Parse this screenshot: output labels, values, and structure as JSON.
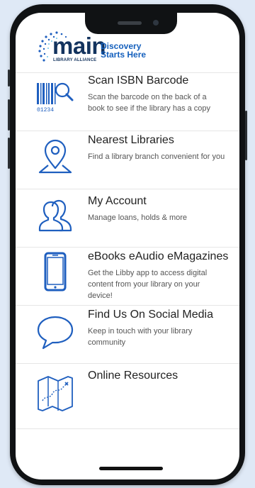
{
  "header": {
    "logo_main": "main",
    "logo_sub": "LIBRARY ALLIANCE",
    "tagline_line1": "Discovery",
    "tagline_line2": "Starts Here"
  },
  "menu": {
    "items": [
      {
        "title": "Scan ISBN Barcode",
        "desc_line1": "Scan the barcode on the back of a",
        "desc_line2": "book to see if the library has a copy",
        "icon": "barcode-scan-icon",
        "barcode_digits": "01234"
      },
      {
        "title": "Nearest Libraries",
        "desc_line1": "Find a library branch convenient for you",
        "desc_line2": "",
        "icon": "location-pin-icon"
      },
      {
        "title": "My Account",
        "desc_line1": "Manage loans, holds & more",
        "desc_line2": "",
        "icon": "users-icon"
      },
      {
        "title": "eBooks eAudio eMagazines",
        "desc_line1": "Get the Libby app to access digital",
        "desc_line2": "content from your library on your",
        "desc_line3": "device!",
        "icon": "smartphone-icon"
      },
      {
        "title": "Find Us On Social Media",
        "desc_line1": "Keep in touch with your library",
        "desc_line2": "community",
        "icon": "chat-bubble-icon"
      },
      {
        "title": "Online Resources",
        "desc_line1": "",
        "desc_line2": "",
        "icon": "map-icon"
      }
    ]
  },
  "colors": {
    "icon_blue": "#1f5fbf",
    "brand_navy": "#13335e",
    "tagline_blue": "#1560bd",
    "background": "#dfe9f6"
  }
}
